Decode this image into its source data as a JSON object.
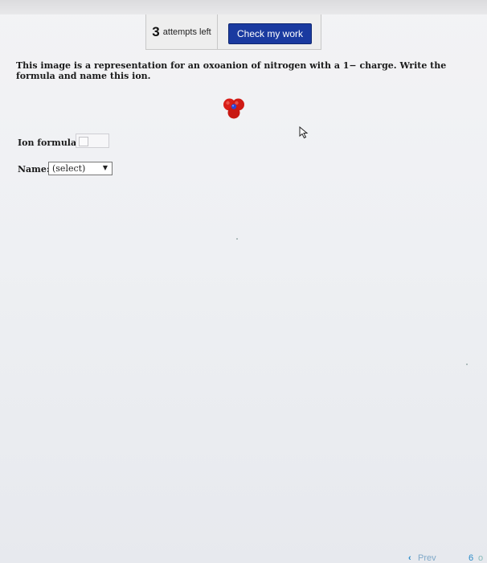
{
  "toolbar": {
    "attempts_count": "3",
    "attempts_label": "attempts left",
    "check_label": "Check my work"
  },
  "question": {
    "text": "This image is a representation for an oxoanion of nitrogen with a 1− charge. Write the formula and name this ion."
  },
  "ion_image": {
    "icon": "nitrite-molecule-model",
    "atom_colors": {
      "oxygen": "#d91e18",
      "nitrogen": "#2846d8"
    }
  },
  "form": {
    "formula_label": "Ion formula:",
    "formula_value": "",
    "name_label": "Name:",
    "name_selected": "(select)"
  },
  "pagination": {
    "prev_label": "Prev",
    "page_number": "6",
    "next_fragment": "o"
  },
  "colors": {
    "button_bg": "#1a3aa0",
    "link": "#2a8ac8"
  }
}
